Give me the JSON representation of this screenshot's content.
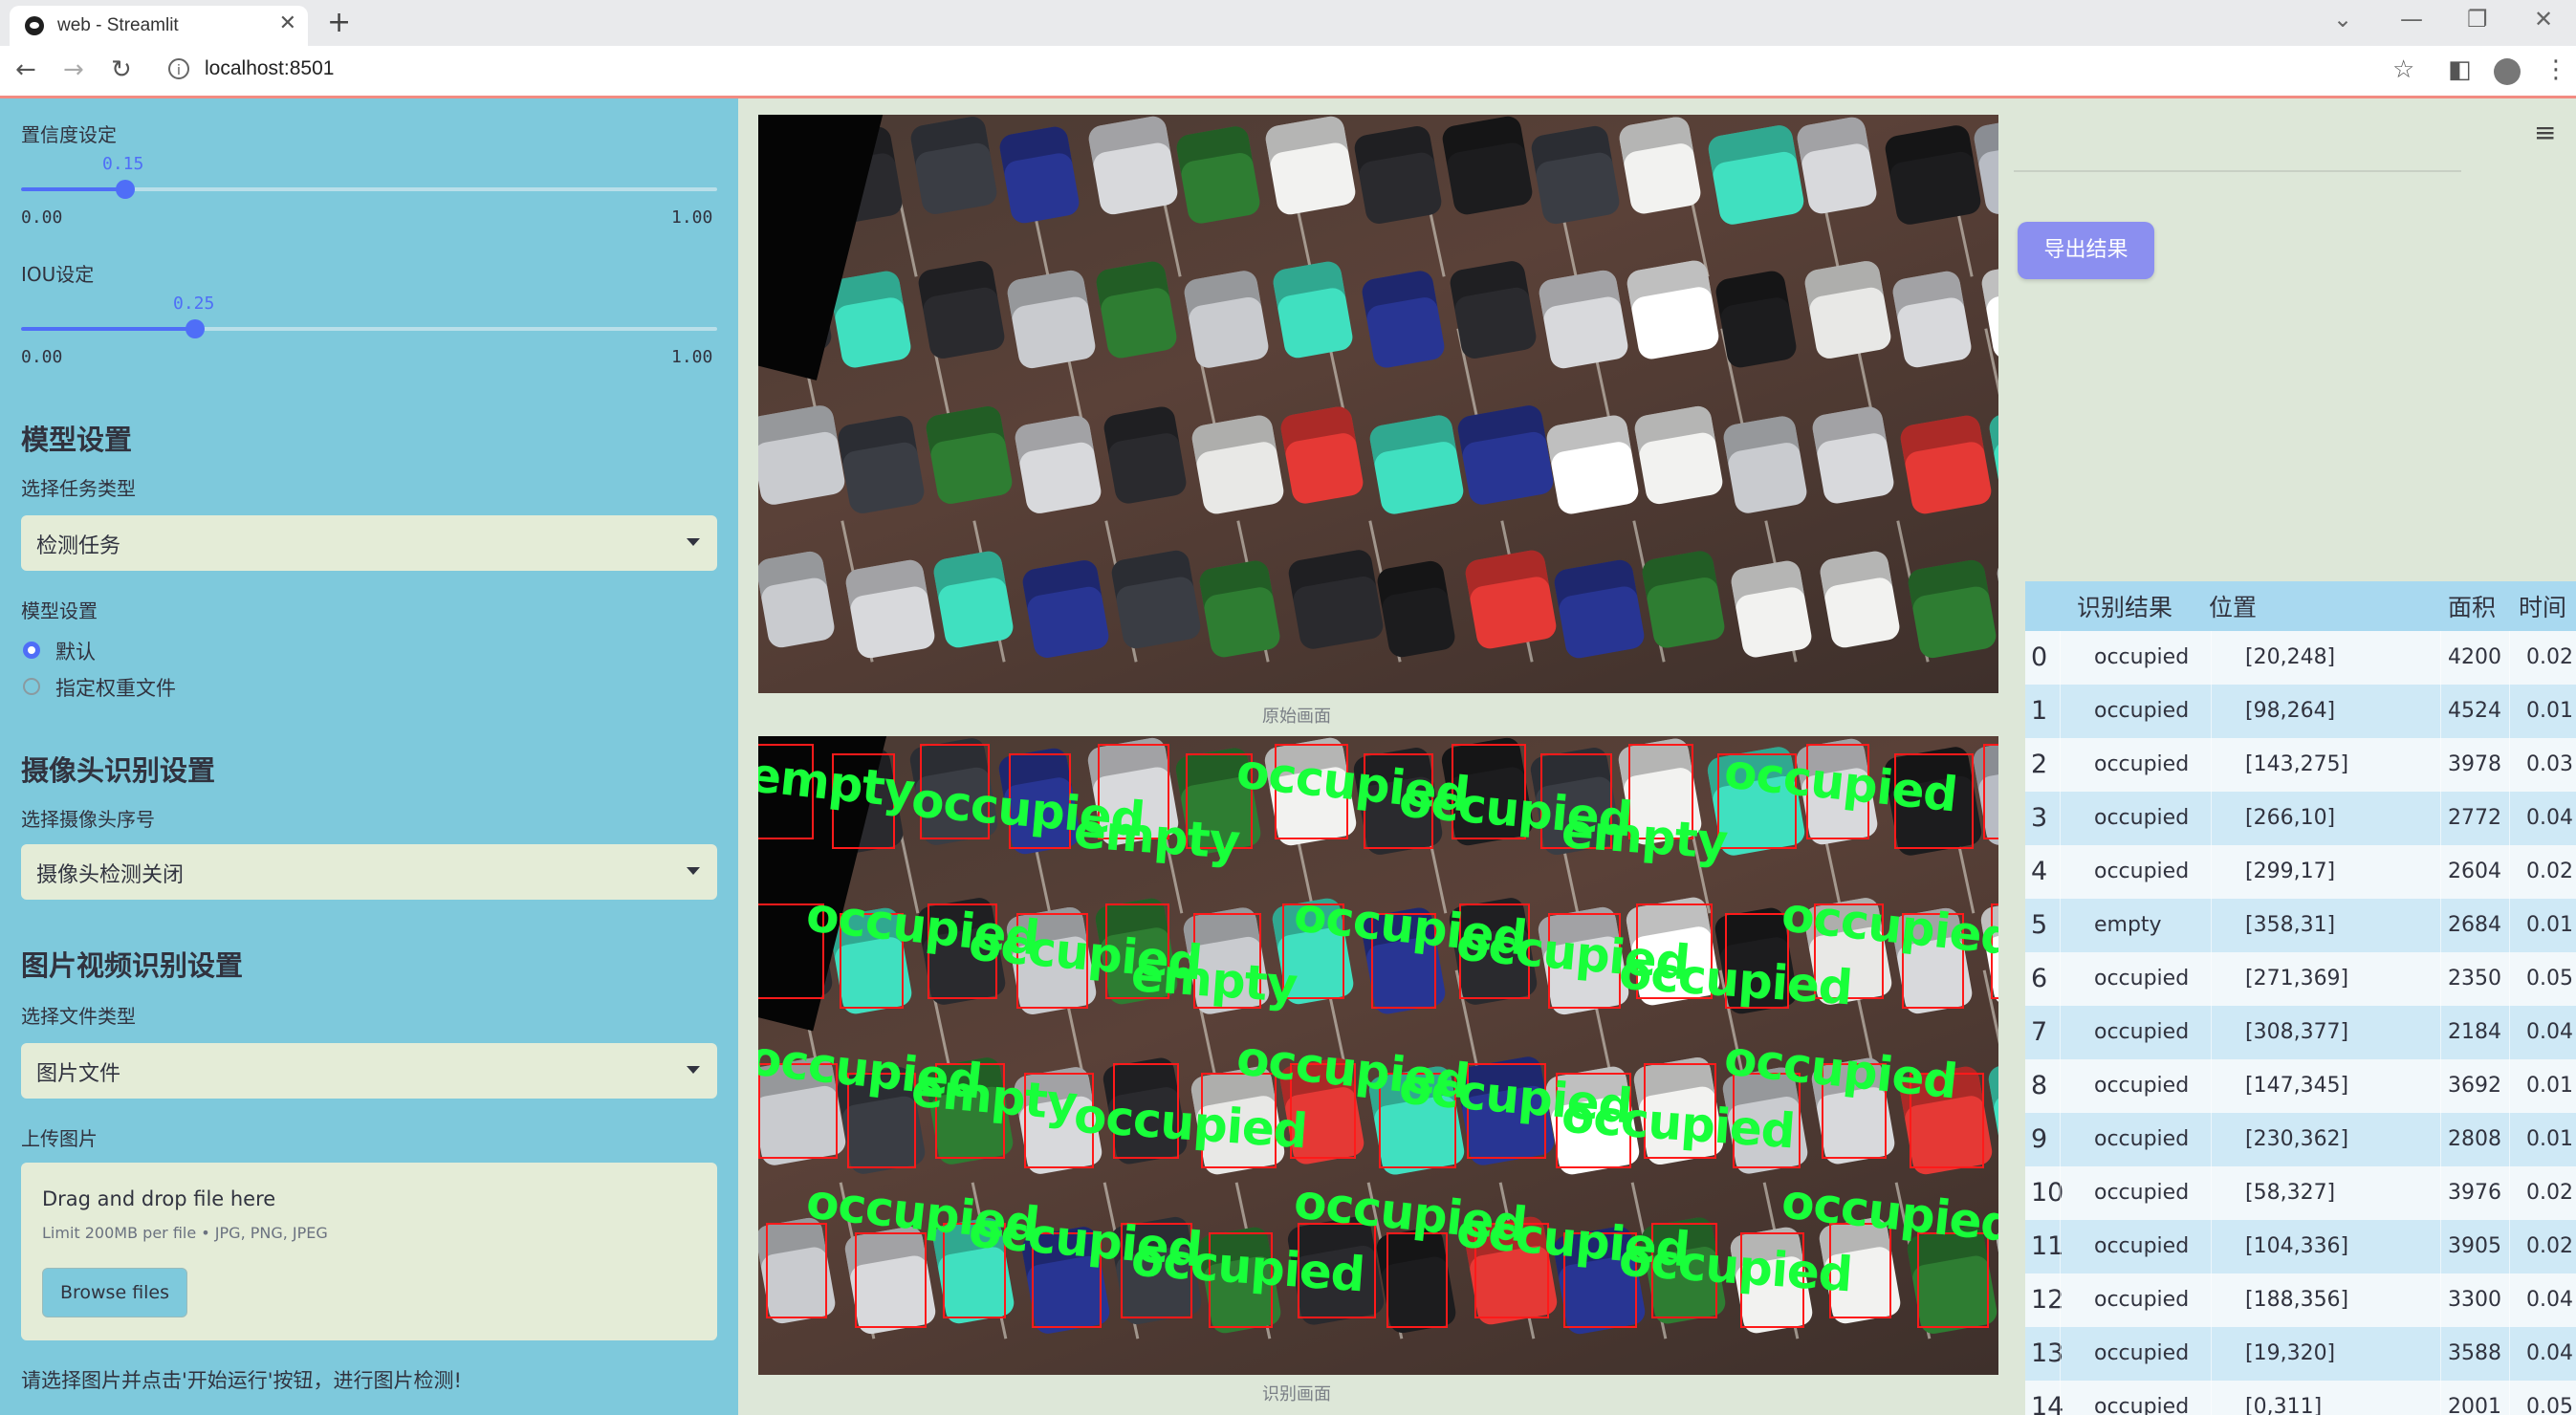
{
  "browser": {
    "tab_title": "web - Streamlit",
    "url": "localhost:8501"
  },
  "sidebar": {
    "confidence": {
      "label": "置信度设定",
      "value": "0.15",
      "min": "0.00",
      "max": "1.00",
      "fraction": 0.15
    },
    "iou": {
      "label": "IOU设定",
      "value": "0.25",
      "min": "0.00",
      "max": "1.00",
      "fraction": 0.25
    },
    "model_section": {
      "title": "模型设置",
      "task_label": "选择任务类型",
      "task_value": "检测任务",
      "model_label": "模型设置",
      "options": [
        "默认",
        "指定权重文件"
      ],
      "selected": 0
    },
    "camera_section": {
      "title": "摄像头识别设置",
      "camera_label": "选择摄像头序号",
      "camera_value": "摄像头检测关闭"
    },
    "media_section": {
      "title": "图片视频识别设置",
      "filetype_label": "选择文件类型",
      "filetype_value": "图片文件",
      "upload_label": "上传图片",
      "drop_text": "Drag and drop file here",
      "limit_text": "Limit 200MB per file • JPG, PNG, JPEG",
      "browse_label": "Browse files"
    },
    "hint": "请选择图片并点击'开始运行'按钮，进行图片检测!"
  },
  "main": {
    "original_caption": "原始画面",
    "result_caption": "识别画面",
    "export_label": "导出结果",
    "detection_labels": [
      "empty",
      "occupied",
      "empty",
      "occupied",
      "occupied",
      "empty",
      "occupied",
      "occupied",
      "occupied",
      "empty",
      "occupied",
      "occupied",
      "occupied",
      "occupied",
      "occupied",
      "empty",
      "occupied",
      "occupied",
      "occupied",
      "occupied",
      "occupied",
      "occupied",
      "occupied",
      "occupied",
      "occupied",
      "occupied",
      "occupied",
      "occupied"
    ]
  },
  "table": {
    "headers": [
      "",
      "识别结果",
      "位置",
      "面积",
      "时间"
    ],
    "rows": [
      {
        "idx": "0",
        "result": "occupied",
        "pos": "[20,248]",
        "area": "4200",
        "time": "0.02"
      },
      {
        "idx": "1",
        "result": "occupied",
        "pos": "[98,264]",
        "area": "4524",
        "time": "0.01"
      },
      {
        "idx": "2",
        "result": "occupied",
        "pos": "[143,275]",
        "area": "3978",
        "time": "0.03"
      },
      {
        "idx": "3",
        "result": "occupied",
        "pos": "[266,10]",
        "area": "2772",
        "time": "0.04"
      },
      {
        "idx": "4",
        "result": "occupied",
        "pos": "[299,17]",
        "area": "2604",
        "time": "0.02"
      },
      {
        "idx": "5",
        "result": "empty",
        "pos": "[358,31]",
        "area": "2684",
        "time": "0.01"
      },
      {
        "idx": "6",
        "result": "occupied",
        "pos": "[271,369]",
        "area": "2350",
        "time": "0.05"
      },
      {
        "idx": "7",
        "result": "occupied",
        "pos": "[308,377]",
        "area": "2184",
        "time": "0.04"
      },
      {
        "idx": "8",
        "result": "occupied",
        "pos": "[147,345]",
        "area": "3692",
        "time": "0.01"
      },
      {
        "idx": "9",
        "result": "occupied",
        "pos": "[230,362]",
        "area": "2808",
        "time": "0.01"
      },
      {
        "idx": "10",
        "result": "occupied",
        "pos": "[58,327]",
        "area": "3976",
        "time": "0.02"
      },
      {
        "idx": "11",
        "result": "occupied",
        "pos": "[104,336]",
        "area": "3905",
        "time": "0.02"
      },
      {
        "idx": "12",
        "result": "occupied",
        "pos": "[188,356]",
        "area": "3300",
        "time": "0.04"
      },
      {
        "idx": "13",
        "result": "occupied",
        "pos": "[19,320]",
        "area": "3588",
        "time": "0.04"
      },
      {
        "idx": "14",
        "result": "occupied",
        "pos": "[0,311]",
        "area": "2001",
        "time": "0.05"
      }
    ]
  },
  "colors": {
    "sidebar_bg": "#7ec9dc",
    "main_bg": "#dde7d8",
    "accent": "#4f6ef7",
    "export_button": "#8b8ff0",
    "box_color": "#ff1a1a",
    "label_color": "#18ff3a",
    "table_header": "#a9d9f0"
  },
  "icons": {
    "back": "arrow-left-icon",
    "forward": "arrow-right-icon",
    "reload": "reload-icon",
    "bookmark": "star-icon",
    "menu": "hamburger-icon"
  }
}
